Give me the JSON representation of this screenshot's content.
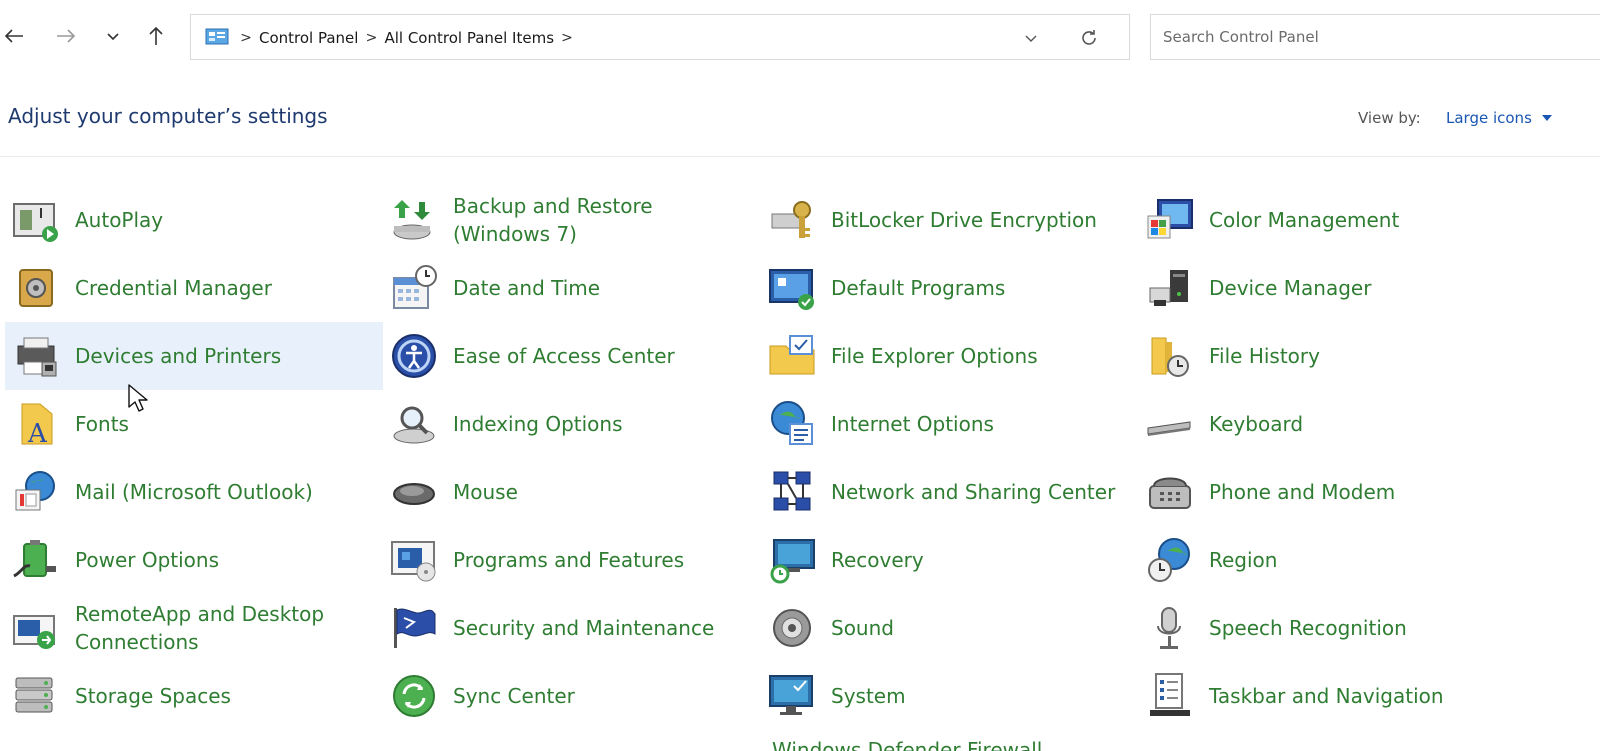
{
  "address": {
    "crumbs": [
      "Control Panel",
      "All Control Panel Items"
    ],
    "search_placeholder": "Search Control Panel"
  },
  "header": {
    "title": "Adjust your computer’s settings",
    "view_by_label": "View by:",
    "view_by_value": "Large icons"
  },
  "items": [
    {
      "label": "AutoPlay",
      "icon": "autoplay-icon"
    },
    {
      "label": "Backup and Restore (Windows 7)",
      "icon": "backup-restore-icon"
    },
    {
      "label": "BitLocker Drive Encryption",
      "icon": "bitlocker-icon"
    },
    {
      "label": "Color Management",
      "icon": "color-management-icon"
    },
    {
      "label": "Credential Manager",
      "icon": "credential-manager-icon"
    },
    {
      "label": "Date and Time",
      "icon": "date-time-icon"
    },
    {
      "label": "Default Programs",
      "icon": "default-programs-icon"
    },
    {
      "label": "Device Manager",
      "icon": "device-manager-icon"
    },
    {
      "label": "Devices and Printers",
      "icon": "devices-printers-icon"
    },
    {
      "label": "Ease of Access Center",
      "icon": "ease-of-access-icon"
    },
    {
      "label": "File Explorer Options",
      "icon": "file-explorer-options-icon"
    },
    {
      "label": "File History",
      "icon": "file-history-icon"
    },
    {
      "label": "Fonts",
      "icon": "fonts-icon"
    },
    {
      "label": "Indexing Options",
      "icon": "indexing-options-icon"
    },
    {
      "label": "Internet Options",
      "icon": "internet-options-icon"
    },
    {
      "label": "Keyboard",
      "icon": "keyboard-icon"
    },
    {
      "label": "Mail (Microsoft Outlook)",
      "icon": "mail-icon"
    },
    {
      "label": "Mouse",
      "icon": "mouse-icon"
    },
    {
      "label": "Network and Sharing Center",
      "icon": "network-sharing-icon"
    },
    {
      "label": "Phone and Modem",
      "icon": "phone-modem-icon"
    },
    {
      "label": "Power Options",
      "icon": "power-options-icon"
    },
    {
      "label": "Programs and Features",
      "icon": "programs-features-icon"
    },
    {
      "label": "Recovery",
      "icon": "recovery-icon"
    },
    {
      "label": "Region",
      "icon": "region-icon"
    },
    {
      "label": "RemoteApp and Desktop Connections",
      "icon": "remoteapp-icon"
    },
    {
      "label": "Security and Maintenance",
      "icon": "security-maintenance-icon"
    },
    {
      "label": "Sound",
      "icon": "sound-icon"
    },
    {
      "label": "Speech Recognition",
      "icon": "speech-recognition-icon"
    },
    {
      "label": "Storage Spaces",
      "icon": "storage-spaces-icon"
    },
    {
      "label": "Sync Center",
      "icon": "sync-center-icon"
    },
    {
      "label": "System",
      "icon": "system-icon"
    },
    {
      "label": "Taskbar and Navigation",
      "icon": "taskbar-navigation-icon"
    }
  ],
  "partial_item": "Windows Defender Firewall",
  "colors": {
    "link_green": "#2f7d32",
    "title_blue": "#1e3a6e",
    "accent_blue": "#1a56b3",
    "hover_bg": "#e8f1fb"
  }
}
